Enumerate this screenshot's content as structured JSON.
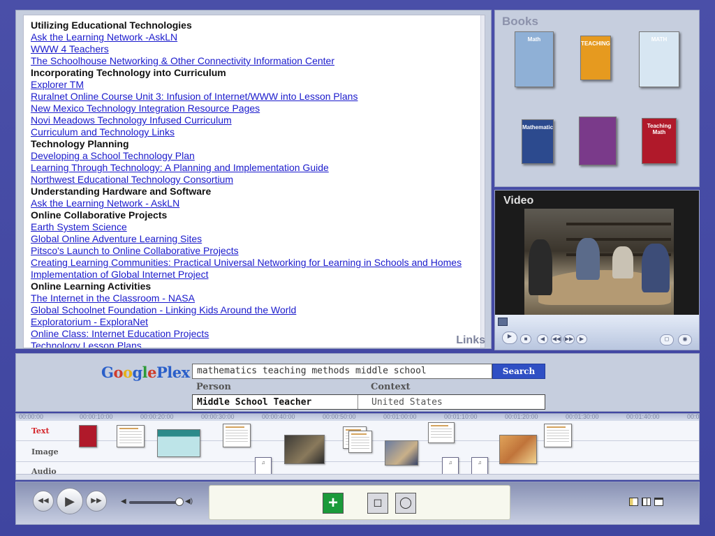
{
  "links": {
    "title": "Links",
    "rows": [
      {
        "type": "head",
        "text": "Utilizing Educational Technologies"
      },
      {
        "type": "link",
        "text": "Ask the Learning Network -AskLN"
      },
      {
        "type": "link",
        "text": "WWW 4 Teachers"
      },
      {
        "type": "link",
        "text": "The Schoolhouse Networking & Other Connectivity Information Center"
      },
      {
        "type": "head",
        "text": "Incorporating Technology into Curriculum"
      },
      {
        "type": "link",
        "text": "Explorer TM"
      },
      {
        "type": "link",
        "text": "Ruralnet Online Course Unit 3: Infusion of Internet/WWW into Lesson Plans"
      },
      {
        "type": "link",
        "text": "New Mexico Technology Integration Resource Pages"
      },
      {
        "type": "link",
        "text": "Novi Meadows Technology Infused Curriculum"
      },
      {
        "type": "link",
        "text": "Curriculum and Technology Links"
      },
      {
        "type": "head",
        "text": "Technology Planning"
      },
      {
        "type": "link",
        "text": "Developing a School Technology Plan"
      },
      {
        "type": "link",
        "text": "Learning Through Technology: A Planning and Implementation Guide"
      },
      {
        "type": "link",
        "text": "Northwest Educational Technology Consortium"
      },
      {
        "type": "head",
        "text": "Understanding Hardware and Software"
      },
      {
        "type": "link",
        "text": "Ask the Learning Network - AskLN"
      },
      {
        "type": "head",
        "text": "Online Collaborative Projects"
      },
      {
        "type": "link",
        "text": "Earth System Science"
      },
      {
        "type": "link",
        "text": "Global Online Adventure Learning Sites"
      },
      {
        "type": "link",
        "text": "Pitsco's Launch to Online Collaborative Projects"
      },
      {
        "type": "link",
        "text": "Creating Learning Communities: Practical Universal Networking for Learning in Schools and Homes"
      },
      {
        "type": "link",
        "text": "Implementation of Global Internet Project"
      },
      {
        "type": "head",
        "text": "Online Learning Activities"
      },
      {
        "type": "link",
        "text": "The Internet in the Classroom - NASA"
      },
      {
        "type": "link",
        "text": "Global Schoolnet Foundation - Linking Kids Around the World"
      },
      {
        "type": "link",
        "text": "Exploratorium - ExploraNet"
      },
      {
        "type": "link",
        "text": "Online Class: Internet Education Projects"
      },
      {
        "type": "link",
        "text": "Technology Lesson Plans"
      }
    ]
  },
  "books": {
    "title": "Books",
    "items": [
      {
        "label": "Math",
        "color": "#8fb0d6"
      },
      {
        "label": "TEACHING",
        "color": "#e69a1f"
      },
      {
        "label": "MATH",
        "color": "#d7e6f2"
      },
      {
        "label": "Mathematics",
        "color": "#2c4a8e"
      },
      {
        "label": "",
        "color": "#7a3a8a"
      },
      {
        "label": "Teaching Math",
        "color": "#b0192a"
      }
    ]
  },
  "video": {
    "title": "Video"
  },
  "search": {
    "brand_g": "G",
    "brand_o1": "o",
    "brand_o2": "o",
    "brand_g2": "g",
    "brand_l": "l",
    "brand_e": "e",
    "brand_plex": "Plex",
    "query": "mathematics teaching methods middle school",
    "button_label": "Search",
    "person_label": "Person",
    "context_label": "Context",
    "person_value": "Middle School Teacher",
    "context_value": "United States"
  },
  "timeline": {
    "ticks": [
      "00:00:00",
      "00:00:10:00",
      "00:00:20:00",
      "00:00:30:00",
      "00:00:40:00",
      "00:00:50:00",
      "00:01:00:00",
      "00:01:10:00",
      "00:01:20:00",
      "00:01:30:00",
      "00:01:40:00",
      "00:01:50:00"
    ],
    "tracks": [
      "Text",
      "Image",
      "Audio"
    ],
    "active_track_color": "#d4262b"
  },
  "toolbar": {
    "rewind_icon": "◀◀",
    "play_icon": "▶",
    "forward_icon": "▶▶",
    "add_icon": "+",
    "comment_icon": "◻",
    "search_icon": "◯"
  }
}
